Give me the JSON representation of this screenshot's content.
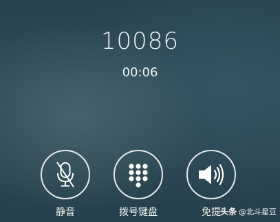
{
  "call": {
    "number": "10086",
    "timer": "00:06"
  },
  "controls": [
    {
      "label": "静音",
      "icon": "microphone-muted-icon"
    },
    {
      "label": "拨号键盘",
      "icon": "dialpad-icon"
    },
    {
      "label": "免提",
      "icon": "speaker-icon"
    }
  ],
  "watermark": {
    "brand": "头条",
    "author": "@北斗星豆"
  },
  "colors": {
    "background": "#2c4753",
    "foreground": "#ffffff"
  }
}
